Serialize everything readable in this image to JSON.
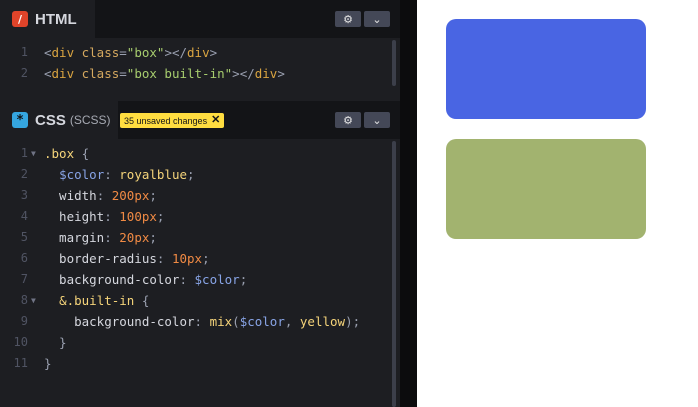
{
  "html_panel": {
    "title": "HTML",
    "icon": "html-logo-icon",
    "lines": [
      {
        "num": "1",
        "tokens": [
          [
            "t-punc",
            "<"
          ],
          [
            "t-tag",
            "div"
          ],
          [
            "t-attr",
            " class"
          ],
          [
            "t-punc",
            "="
          ],
          [
            "t-str",
            "\"box\""
          ],
          [
            "t-punc",
            ">"
          ],
          [
            "t-punc",
            "</"
          ],
          [
            "t-tag",
            "div"
          ],
          [
            "t-punc",
            ">"
          ]
        ]
      },
      {
        "num": "2",
        "tokens": [
          [
            "t-punc",
            "<"
          ],
          [
            "t-tag",
            "div"
          ],
          [
            "t-attr",
            " class"
          ],
          [
            "t-punc",
            "="
          ],
          [
            "t-str",
            "\"box built-in\""
          ],
          [
            "t-punc",
            ">"
          ],
          [
            "t-punc",
            "</"
          ],
          [
            "t-tag",
            "div"
          ],
          [
            "t-punc",
            ">"
          ]
        ]
      }
    ]
  },
  "css_panel": {
    "title": "CSS",
    "subtitle": "(SCSS)",
    "icon": "css-logo-icon",
    "badge": "35 unsaved changes",
    "lines": [
      {
        "num": "1",
        "fold": true,
        "tokens": [
          [
            "t-sel",
            ".box"
          ],
          [
            "t-punc",
            " {"
          ]
        ]
      },
      {
        "num": "2",
        "tokens": [
          [
            "t-prop",
            "  "
          ],
          [
            "t-var",
            "$color"
          ],
          [
            "t-punc",
            ": "
          ],
          [
            "t-val",
            "royalblue"
          ],
          [
            "t-punc",
            ";"
          ]
        ]
      },
      {
        "num": "3",
        "tokens": [
          [
            "t-prop",
            "  width"
          ],
          [
            "t-punc",
            ": "
          ],
          [
            "t-num",
            "200px"
          ],
          [
            "t-punc",
            ";"
          ]
        ]
      },
      {
        "num": "4",
        "tokens": [
          [
            "t-prop",
            "  height"
          ],
          [
            "t-punc",
            ": "
          ],
          [
            "t-num",
            "100px"
          ],
          [
            "t-punc",
            ";"
          ]
        ]
      },
      {
        "num": "5",
        "tokens": [
          [
            "t-prop",
            "  margin"
          ],
          [
            "t-punc",
            ": "
          ],
          [
            "t-num",
            "20px"
          ],
          [
            "t-punc",
            ";"
          ]
        ]
      },
      {
        "num": "6",
        "tokens": [
          [
            "t-prop",
            "  border-radius"
          ],
          [
            "t-punc",
            ": "
          ],
          [
            "t-num",
            "10px"
          ],
          [
            "t-punc",
            ";"
          ]
        ]
      },
      {
        "num": "7",
        "tokens": [
          [
            "t-prop",
            "  background-color"
          ],
          [
            "t-punc",
            ": "
          ],
          [
            "t-var",
            "$color"
          ],
          [
            "t-punc",
            ";"
          ]
        ]
      },
      {
        "num": "8",
        "fold": true,
        "tokens": [
          [
            "t-prop",
            "  "
          ],
          [
            "t-sel",
            "&.built-in"
          ],
          [
            "t-punc",
            " {"
          ]
        ]
      },
      {
        "num": "9",
        "tokens": [
          [
            "t-prop",
            "    background-color"
          ],
          [
            "t-punc",
            ": "
          ],
          [
            "t-fn",
            "mix"
          ],
          [
            "t-punc",
            "("
          ],
          [
            "t-var",
            "$color"
          ],
          [
            "t-punc",
            ", "
          ],
          [
            "t-val",
            "yellow"
          ],
          [
            "t-punc",
            ");"
          ]
        ]
      },
      {
        "num": "10",
        "tokens": [
          [
            "t-punc",
            "  }"
          ]
        ]
      },
      {
        "num": "11",
        "tokens": [
          [
            "t-punc",
            "}"
          ]
        ]
      }
    ]
  },
  "icons": {
    "settings": "gear-icon",
    "collapse": "chevron-down-icon",
    "badge_close": "close-icon"
  },
  "preview": {
    "boxes": [
      {
        "class": "box",
        "color": "#4965e3"
      },
      {
        "class": "box built-in",
        "color": "#a2b36f"
      }
    ]
  }
}
